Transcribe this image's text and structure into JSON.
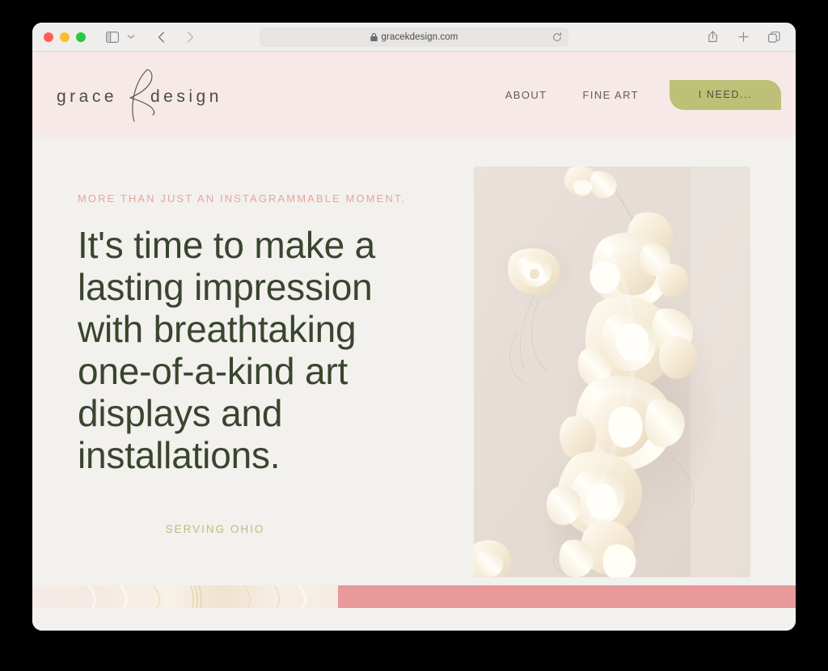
{
  "browser": {
    "url": "gracekdesign.com",
    "lock_icon": "lock-icon",
    "traffic_lights": [
      "close",
      "minimize",
      "maximize"
    ],
    "sidebar_icon": "sidebar-toggle-icon",
    "chevron_icon": "chevron-down-icon",
    "back_icon": "back-arrow-icon",
    "forward_icon": "forward-arrow-icon",
    "reload_icon": "reload-icon",
    "share_icon": "share-icon",
    "newtab_icon": "plus-icon",
    "tabs_icon": "tab-overview-icon"
  },
  "site": {
    "logo": {
      "word_left": "grace",
      "word_right": "design",
      "monogram": "k"
    },
    "nav": {
      "links": [
        {
          "label": "ABOUT"
        },
        {
          "label": "FINE ART"
        }
      ],
      "cta_label": "I NEED..."
    },
    "hero": {
      "eyebrow": "MORE THAN JUST AN INSTAGRAMMABLE MOMENT.",
      "headline": "It's time to make a lasting impression with breathtaking one-of-a-kind art displays and installations.",
      "location": "SERVING OHIO",
      "image_alt": "cream ribbon art installation"
    },
    "footer_strip": {
      "image_alt": "cream fabric detail",
      "color_block": "#e9999a"
    },
    "colors": {
      "header_band": "#f6e9e8",
      "body": "#f2f1ee",
      "accent_green": "#bcc177",
      "accent_pink": "#eca2a0",
      "headline_green": "#3a452f",
      "serving_olive": "#bcbd7c"
    }
  }
}
